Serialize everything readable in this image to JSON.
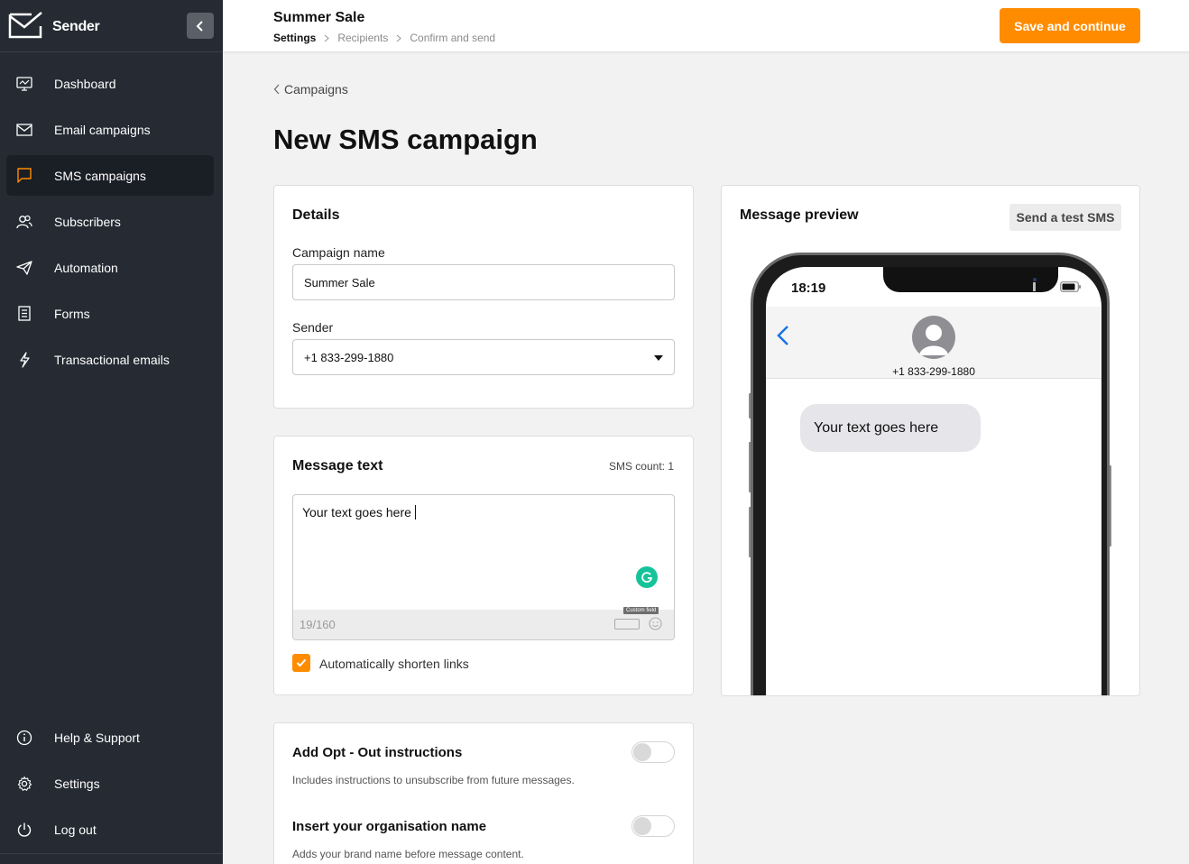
{
  "sidebar": {
    "brand": "Sender",
    "items": [
      {
        "label": "Dashboard",
        "icon": "dashboard-icon"
      },
      {
        "label": "Email campaigns",
        "icon": "envelope-icon"
      },
      {
        "label": "SMS campaigns",
        "icon": "chat-bubble-icon",
        "active": true
      },
      {
        "label": "Subscribers",
        "icon": "users-icon"
      },
      {
        "label": "Automation",
        "icon": "paper-plane-icon"
      },
      {
        "label": "Forms",
        "icon": "form-icon"
      },
      {
        "label": "Transactional emails",
        "icon": "lightning-icon"
      }
    ],
    "bottom_items": [
      {
        "label": "Help & Support",
        "icon": "info-icon"
      },
      {
        "label": "Settings",
        "icon": "gear-icon"
      },
      {
        "label": "Log out",
        "icon": "power-icon"
      }
    ]
  },
  "header": {
    "title": "Summer Sale",
    "steps": [
      "Settings",
      "Recipients",
      "Confirm and send"
    ],
    "save_label": "Save and continue"
  },
  "main": {
    "back_label": "Campaigns",
    "page_title": "New SMS campaign"
  },
  "details": {
    "title": "Details",
    "campaign_name_label": "Campaign name",
    "campaign_name_value": "Summer Sale",
    "sender_label": "Sender",
    "sender_value": "+1 833-299-1880"
  },
  "message": {
    "title": "Message text",
    "sms_count": "SMS count: 1",
    "text": "Your text goes here",
    "char_count": "19/160",
    "custom_field_tip": "Custom field",
    "shorten_links_label": "Automatically shorten links",
    "shorten_links_checked": true
  },
  "options": [
    {
      "title": "Add Opt - Out instructions",
      "desc": "Includes instructions to unsubscribe from future messages.",
      "enabled": false
    },
    {
      "title": "Insert your organisation name",
      "desc": "Adds your brand name before message content.",
      "enabled": false
    }
  ],
  "preview": {
    "title": "Message preview",
    "test_label": "Send a test SMS",
    "time": "18:19",
    "contact": "+1 833-299-1880",
    "bubble_text": "Your text goes here"
  },
  "colors": {
    "accent": "#ff8c00",
    "sidebar_bg": "#252a33",
    "sidebar_active": "#1a1e25",
    "ios_blue": "#1a73e8",
    "grammarly": "#15c39a"
  }
}
